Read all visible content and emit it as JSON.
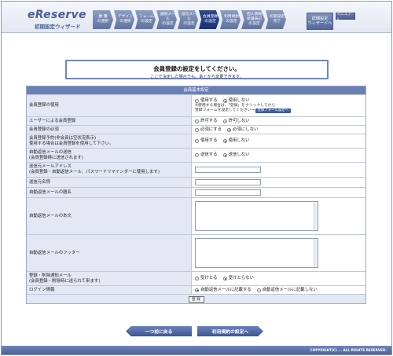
{
  "header": {
    "logo": "eReserve",
    "logo_sub": "初期設定ウィザード",
    "steps": [
      {
        "label": "業 種\nの選択",
        "active": false
      },
      {
        "label": "デザイン\nの選択",
        "active": false
      },
      {
        "label": "フォーム\nの設定",
        "active": false
      },
      {
        "label": "通知メール\nの設定",
        "active": false
      },
      {
        "label": "返信メール\nの設定",
        "active": false
      },
      {
        "label": "会員登録\nの設定",
        "active": true
      },
      {
        "label": "利用規約\nの設定",
        "active": false
      },
      {
        "label": "個人情報\n保護表記\nの設定",
        "active": false
      },
      {
        "label": "初期設定\n完了",
        "active": false
      }
    ],
    "wizard_button": "詳細設定\nウィザードへ",
    "manual_button": "マニュアル"
  },
  "title": {
    "main": "会員登録の設定をしてください。",
    "sub": "ここで決定した場合でも、あとから変更できます。"
  },
  "form": {
    "heading": "会員基本設定",
    "membership": {
      "label": "会員登録の使用",
      "options": [
        "使用する",
        "使用しない"
      ],
      "note1": "※使用する場合は、「登録」をクリックしてから",
      "note2": "登録フォームを設定してください→",
      "form_button": "登録フォーム設定へ"
    },
    "user_register": {
      "label": "ユーザーによる会員登録",
      "options": [
        "許可する",
        "許可しない"
      ]
    },
    "required": {
      "label": "会員登録の必須",
      "options": [
        "必須にする",
        "必須にしない"
      ]
    },
    "pre_reserve": {
      "label1": "会員登録予約(非会員は空状況表示)",
      "label2": "使用する場合は会員登録を使用して下さい。",
      "options": [
        "使用する",
        "使用しない"
      ]
    },
    "auto_reply": {
      "label1": "自動返信メールの送信",
      "label2": "(会員登録時に送信されます)",
      "options": [
        "送信する",
        "送信しない"
      ]
    },
    "sender_address": {
      "label1": "送信元メールアドレス",
      "label2": "(会員登録・自動返信メール、パスワードリマインダーに使用します)"
    },
    "sender_name": {
      "label": "送信元名称"
    },
    "auto_subject": {
      "label": "自動返信メールの題名"
    },
    "auto_body": {
      "label": "自動返信メールの本文"
    },
    "auto_footer": {
      "label": "自動返信メールのフッター"
    },
    "notify": {
      "label1": "登録・削除通知メール",
      "label2": "(会員登録・削除時に送られて来ます)",
      "options": [
        "受けとる",
        "受けとらない"
      ]
    },
    "login_info": {
      "label": "ログイン情報",
      "options": [
        "自動返信メールに記載する",
        "自動返信メールに記載しない"
      ]
    },
    "submit": "登 録"
  },
  "nav": {
    "prev": "一つ前に戻る",
    "next": "利用規約の設定へ"
  },
  "footer": {
    "copyright": "COPYRIGHT(C) ... ALL RIGHTS RESERVED."
  }
}
